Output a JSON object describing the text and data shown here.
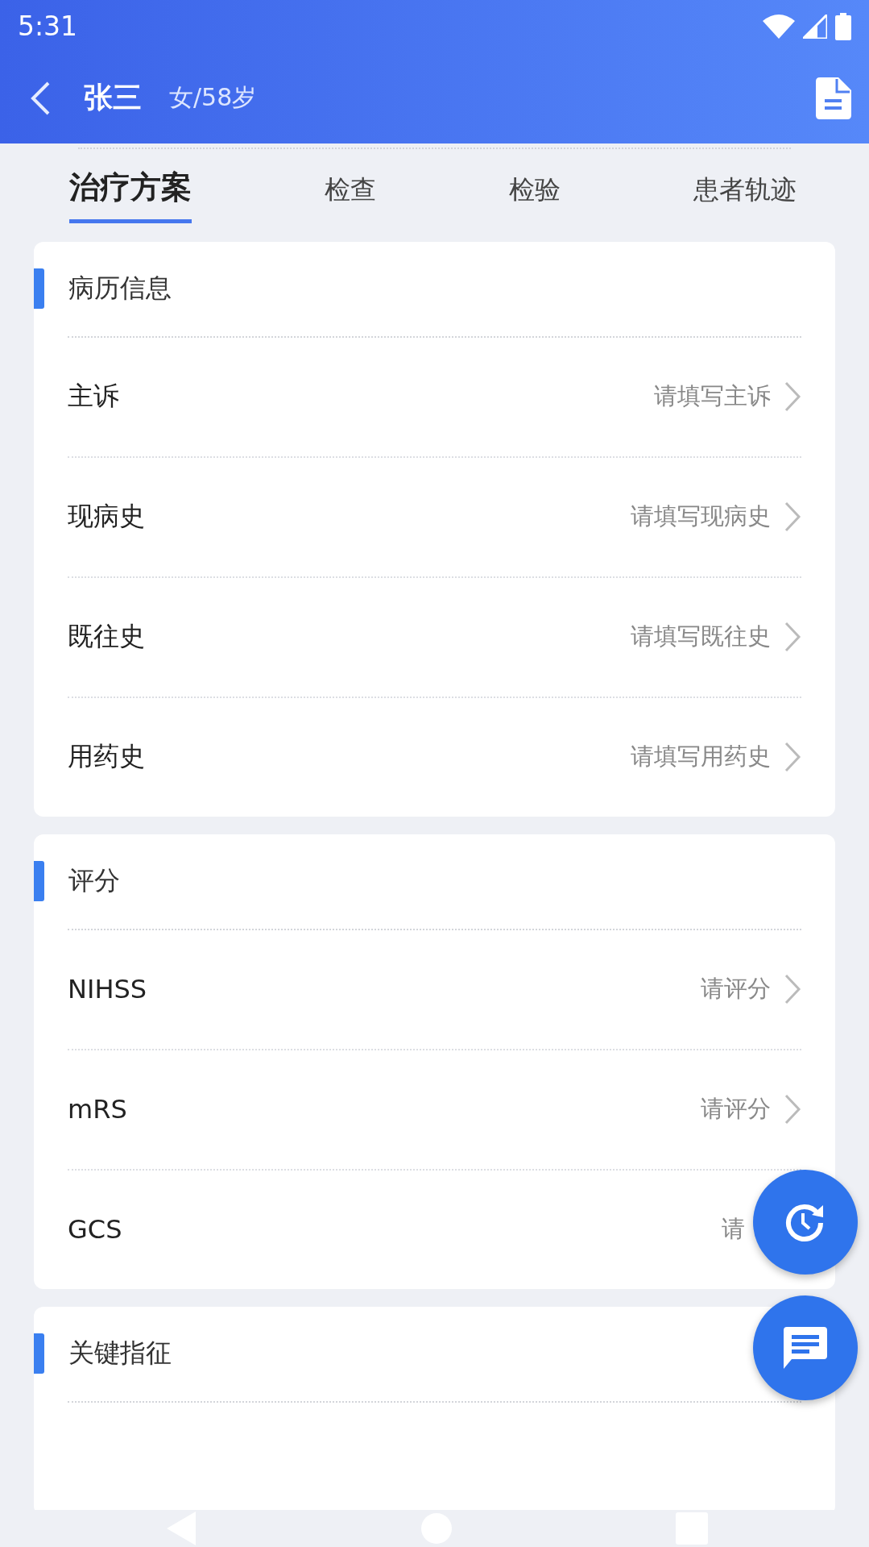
{
  "status_bar": {
    "time": "5:31"
  },
  "header": {
    "name": "张三",
    "info": "女/58岁"
  },
  "tabs": [
    {
      "label": "治疗方案",
      "selected": true
    },
    {
      "label": "检查",
      "selected": false
    },
    {
      "label": "检验",
      "selected": false
    },
    {
      "label": "患者轨迹",
      "selected": false
    }
  ],
  "sections": [
    {
      "title": "病历信息",
      "rows": [
        {
          "label": "主诉",
          "value": "请填写主诉",
          "chevron": true
        },
        {
          "label": "现病史",
          "value": "请填写现病史",
          "chevron": true
        },
        {
          "label": "既往史",
          "value": "请填写既往史",
          "chevron": true
        },
        {
          "label": "用药史",
          "value": "请填写用药史",
          "chevron": true
        }
      ]
    },
    {
      "title": "评分",
      "rows": [
        {
          "label": "NIHSS",
          "value": "请评分",
          "chevron": true
        },
        {
          "label": "mRS",
          "value": "请评分",
          "chevron": true
        },
        {
          "label": "GCS",
          "value": "请",
          "chevron": false
        }
      ]
    },
    {
      "title": "关键指征"
    }
  ]
}
